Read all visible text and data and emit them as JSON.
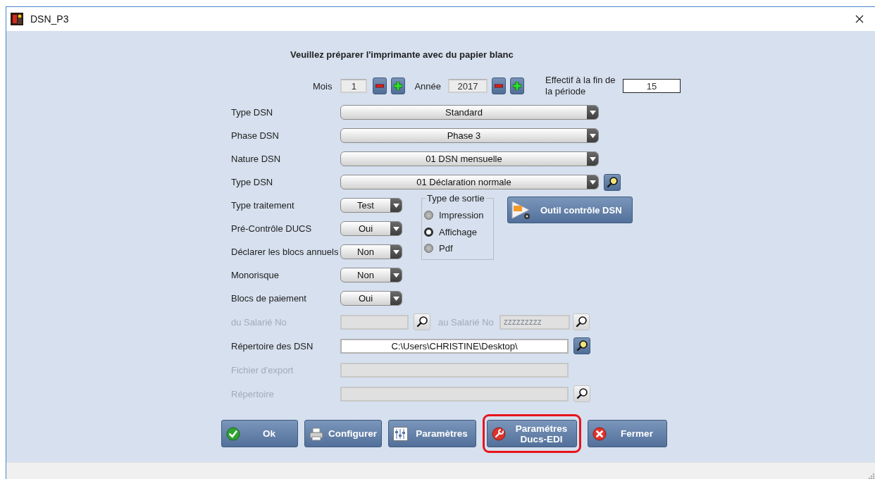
{
  "window": {
    "title": "DSN_P3"
  },
  "instruction": "Veuillez préparer l'imprimante avec du papier blanc",
  "period": {
    "month_label": "Mois",
    "month": "1",
    "year_label": "Année",
    "year": "2017",
    "headcount_label": "Effectif à la fin de la période",
    "headcount": "15"
  },
  "rows": [
    {
      "kind": "combo",
      "label": "Type DSN",
      "value": "Standard",
      "lookup": false,
      "disabled": false
    },
    {
      "kind": "combo",
      "label": "Phase DSN",
      "value": "Phase 3",
      "lookup": false,
      "disabled": false
    },
    {
      "kind": "combo",
      "label": "Nature DSN",
      "value": "01 DSN mensuelle",
      "lookup": false,
      "disabled": false
    },
    {
      "kind": "combo",
      "label": "Type DSN",
      "value": "01 Déclaration normale",
      "lookup": true,
      "disabled": false
    },
    {
      "kind": "small-combo",
      "label": "Type traitement",
      "value": "Test",
      "disabled": false
    },
    {
      "kind": "small-combo",
      "label": "Pré-Contrôle DUCS",
      "value": "Oui",
      "disabled": false
    },
    {
      "kind": "small-combo",
      "label": "Déclarer les blocs annuels",
      "value": "Non",
      "disabled": false
    },
    {
      "kind": "small-combo",
      "label": "Monorisque",
      "value": "Non",
      "disabled": false
    },
    {
      "kind": "small-combo",
      "label": "Blocs de paiement",
      "value": "Oui",
      "disabled": false
    },
    {
      "kind": "range",
      "label": "du Salarié No",
      "to_label": "au Salarié No",
      "to_value": "zzzzzzzzz",
      "lookup": true,
      "disabled": true
    },
    {
      "kind": "field",
      "label": "Répertoire des DSN",
      "value": "C:\\Users\\CHRISTINE\\Desktop\\",
      "lookup": true,
      "disabled": false
    },
    {
      "kind": "field",
      "label": "Fichier d'export",
      "lookup": false,
      "disabled": true
    },
    {
      "kind": "field",
      "label": "Répertoire",
      "lookup": true,
      "disabled": true
    }
  ],
  "output_type": {
    "title": "Type de sortie",
    "options": [
      {
        "label": "Impression",
        "selected": false
      },
      {
        "label": "Affichage",
        "selected": true
      },
      {
        "label": "Pdf",
        "selected": false
      }
    ]
  },
  "tool_button": {
    "label": "Outil contrôle DSN"
  },
  "buttons": [
    {
      "kind": "ok",
      "label": "Ok",
      "highlighted": false
    },
    {
      "kind": "configure",
      "label": "Configurer",
      "highlighted": false
    },
    {
      "kind": "settings",
      "label": "Paramètres",
      "highlighted": false
    },
    {
      "kind": "tools",
      "label": "Paramétres Ducs-EDI",
      "highlighted": true
    },
    {
      "kind": "close",
      "label": "Fermer",
      "highlighted": false
    }
  ]
}
